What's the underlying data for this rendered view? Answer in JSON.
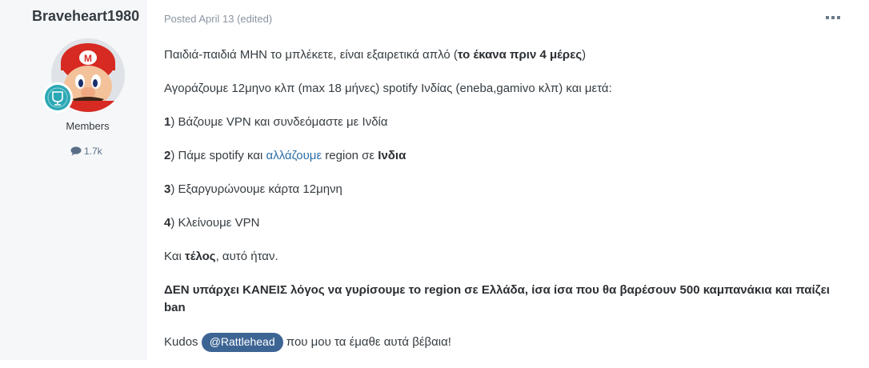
{
  "author": {
    "name": "Braveheart1980",
    "group": "Members",
    "post_count": "1.7k"
  },
  "post": {
    "posted": "Posted April 13",
    "edited": "(edited)",
    "p1_text": "Παιδιά-παιδιά ΜΗΝ το μπλέκετε, είναι εξαιρετικά απλό (",
    "p1_bold": "το έκανα πριν 4 μέρες",
    "p1_end": ")",
    "p2_text": "Αγοράζουμε 12μηνο κλπ (max 18 μήνες) spotify Ινδίας (eneba,gamivo κλπ) και μετά:",
    "s1_num": "1",
    "s1_text": ") Βάζουμε VPN και συνδεόμαστε με Ινδία",
    "s2_num": "2",
    "s2_text_a": ") Πάμε spotify και ",
    "s2_link": "αλλάζουμε",
    "s2_text_b": " region σε ",
    "s2_bold": "Ινδια",
    "s3_num": "3",
    "s3_text": ") Εξαργυρώνουμε κάρτα 12μηνη",
    "s4_num": "4",
    "s4_text": ") Κλείνουμε VPN",
    "p7_a": "Και ",
    "p7_bold": "τέλος",
    "p7_b": ", αυτό ήταν.",
    "p8_bold": "ΔΕΝ υπάρχει ΚΑΝΕΙΣ λόγος να γυρίσουμε το region σε Ελλάδα, ίσα ίσα που θα βαρέσουν 500 καμπανάκια και παίζει ban",
    "p9_a": "Kudos ",
    "mention": "@Rattlehead",
    "p9_b": " που μου τα έμαθε αυτά βέβαια!"
  },
  "colors": {
    "accent": "#3d6594",
    "link": "#2d6ea6",
    "badge": "#2ba8b5"
  },
  "icons": {
    "post_count": "comment-icon",
    "rank": "rank-badge-icon",
    "menu": "more-options-icon"
  }
}
